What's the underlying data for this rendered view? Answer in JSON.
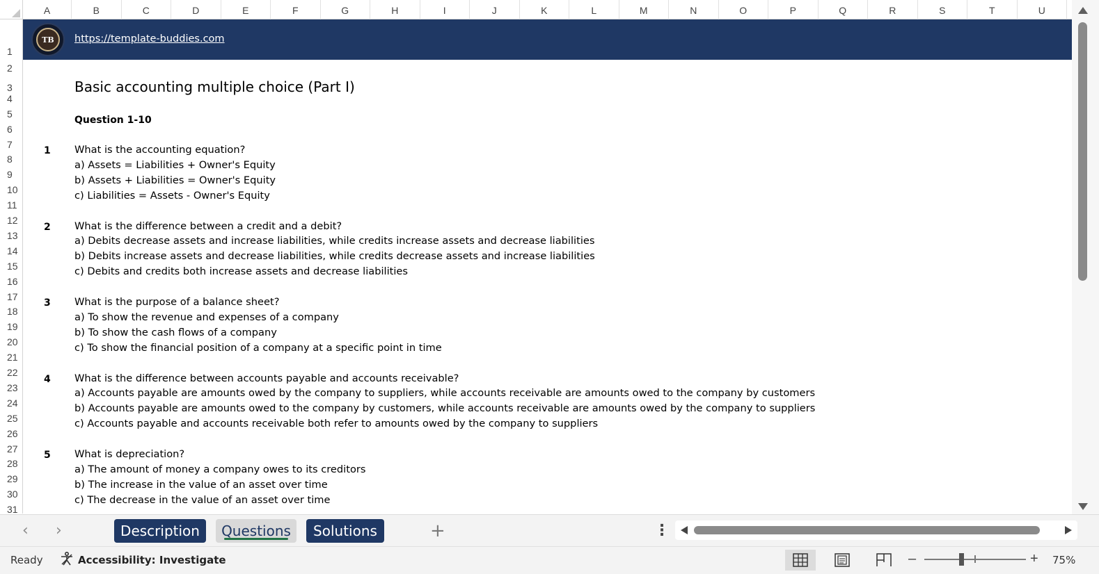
{
  "columns": [
    "A",
    "B",
    "C",
    "D",
    "E",
    "F",
    "G",
    "H",
    "I",
    "J",
    "K",
    "L",
    "M",
    "N",
    "O",
    "P",
    "Q",
    "R",
    "S",
    "T",
    "U"
  ],
  "rows": [
    "1",
    "2",
    "3",
    "4",
    "5",
    "6",
    "7",
    "8",
    "9",
    "10",
    "11",
    "12",
    "13",
    "14",
    "15",
    "16",
    "17",
    "18",
    "19",
    "20",
    "21",
    "22",
    "23",
    "24",
    "25",
    "26",
    "27",
    "28",
    "29",
    "30",
    "31"
  ],
  "header": {
    "logo_text": "TB",
    "link": "https://template-buddies.com"
  },
  "content": {
    "title": "Basic accounting multiple choice (Part I)",
    "subtitle": "Question 1-10",
    "questions": [
      {
        "number": "1",
        "question": "What is the accounting equation?",
        "options": [
          "a) Assets = Liabilities + Owner's Equity",
          "b) Assets + Liabilities = Owner's Equity",
          "c) Liabilities = Assets - Owner's Equity"
        ]
      },
      {
        "number": "2",
        "question": "What is the difference between a credit and a debit?",
        "options": [
          "a) Debits decrease assets and increase liabilities, while credits increase assets and decrease liabilities",
          "b) Debits increase assets and decrease liabilities, while credits decrease assets and increase liabilities",
          "c) Debits and credits both increase assets and decrease liabilities"
        ]
      },
      {
        "number": "3",
        "question": "What is the purpose of a balance sheet?",
        "options": [
          "a) To show the revenue and expenses of a company",
          "b) To show the cash flows of a company",
          "c) To show the financial position of a company at a specific point in time"
        ]
      },
      {
        "number": "4",
        "question": "What is the difference between accounts payable and accounts receivable?",
        "options": [
          "a) Accounts payable are amounts owed by the company to suppliers, while accounts receivable are amounts owed to the company by customers",
          "b) Accounts payable are amounts owed to the company by customers, while accounts receivable are amounts owed by the company to suppliers",
          "c) Accounts payable and accounts receivable both refer to amounts owed by the company to suppliers"
        ]
      },
      {
        "number": "5",
        "question": "What is depreciation?",
        "options": [
          "a) The amount of money a company owes to its creditors",
          "b) The increase in the value of an asset over time",
          "c) The decrease in the value of an asset over time"
        ]
      }
    ]
  },
  "tabs": [
    {
      "label": "Description",
      "active": false
    },
    {
      "label": "Questions",
      "active": true
    },
    {
      "label": "Solutions",
      "active": false
    }
  ],
  "statusbar": {
    "ready": "Ready",
    "accessibility": "Accessibility: Investigate",
    "zoom": "75%"
  },
  "colors": {
    "banner": "#1f3864",
    "active_tab_underline": "#217346"
  }
}
